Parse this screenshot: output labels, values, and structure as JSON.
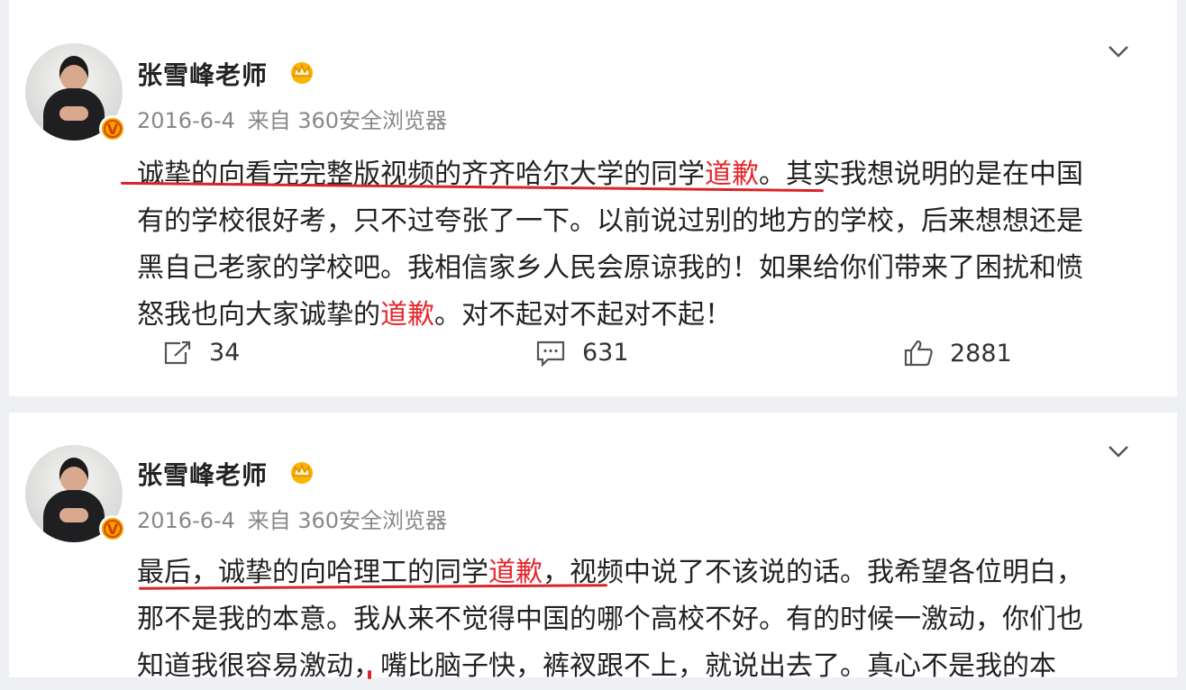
{
  "posts": [
    {
      "author": "张雪峰老师",
      "date": "2016-6-4",
      "source": "来自 360安全浏览器",
      "lines": [
        [
          {
            "t": "诚挚的向看完完整版视频的齐齐哈尔大学的同学"
          },
          {
            "t": "道歉",
            "hl": true
          },
          {
            "t": "。其实我想说明的是在中国"
          }
        ],
        [
          {
            "t": "有的学校很好考，只不过夸张了一下。以前说过别的地方的学校，后来想想还是"
          }
        ],
        [
          {
            "t": "黑自己老家的学校吧。我相信家乡人民会原谅我的！如果给你们带来了困扰和愤"
          }
        ],
        [
          {
            "t": "怒我也向大家诚挚的"
          },
          {
            "t": "道歉",
            "hl": true
          },
          {
            "t": "。对不起对不起对不起！"
          }
        ]
      ],
      "repost_count": "34",
      "comment_count": "631",
      "like_count": "2881"
    },
    {
      "author": "张雪峰老师",
      "date": "2016-6-4",
      "source": "来自 360安全浏览器",
      "lines": [
        [
          {
            "t": "最后，诚挚的向哈理工的同学"
          },
          {
            "t": "道歉",
            "hl": true
          },
          {
            "t": "，视频中说了不该说的话。我希望各位明白，"
          }
        ],
        [
          {
            "t": "那不是我的本意。我从来不觉得中国的哪个高校不好。有的时候一激动，你们也"
          }
        ],
        [
          {
            "t": "知道我很容易激动，嘴比脑子快，裤衩跟不上，就说出去了。真心不是我的本"
          }
        ]
      ]
    }
  ],
  "colors": {
    "highlight": "#e5262c",
    "underline": "#d8242a",
    "verified": "#f5a300"
  },
  "icons": [
    "crown-icon",
    "verified-badge-icon",
    "chevron-down-icon",
    "repost-icon",
    "comment-icon",
    "like-icon"
  ]
}
